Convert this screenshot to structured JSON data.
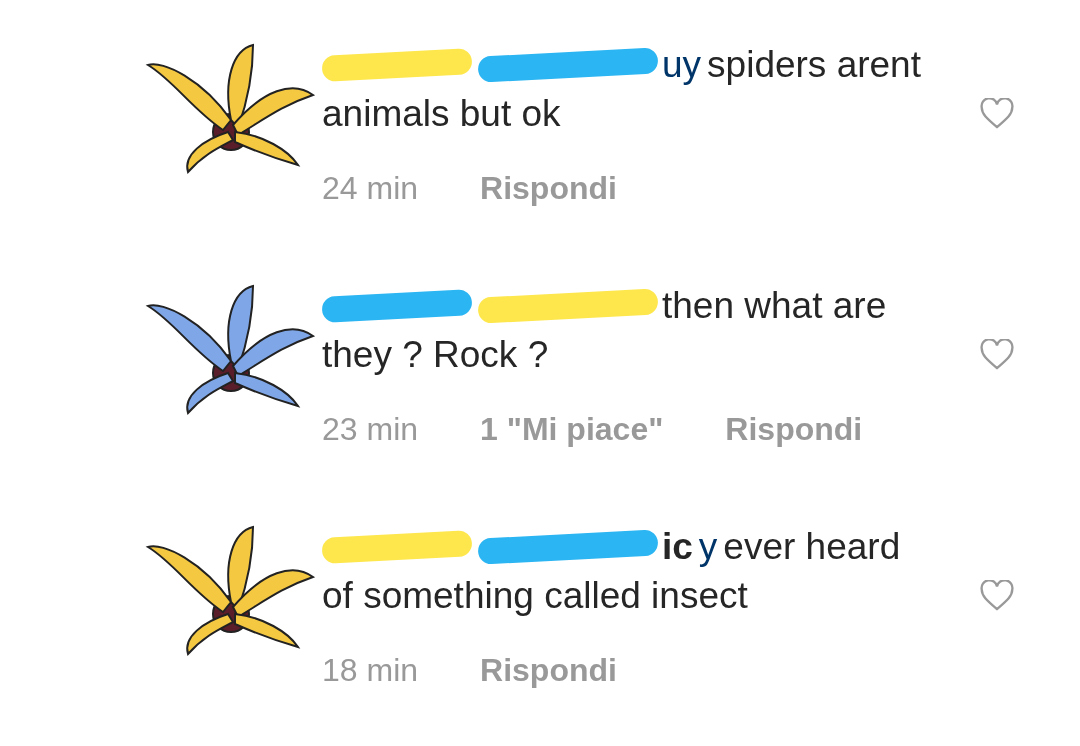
{
  "comments": [
    {
      "color": "#f5c842",
      "redactions": [
        {
          "color": "#fde74c"
        },
        {
          "color": "#2bb5f2"
        }
      ],
      "mention_tail": "uy",
      "text": "spiders arent animals but ok",
      "time": "24 min",
      "reply": "Rispondi",
      "liked": false
    },
    {
      "color": "#7fa7e8",
      "redactions": [
        {
          "color": "#2bb5f2"
        },
        {
          "color": "#fde74c"
        }
      ],
      "text": "then what are they ? Rock ?",
      "time": "23 min",
      "likes": "1 \"Mi piace\"",
      "reply": "Rispondi",
      "liked": false
    },
    {
      "color": "#f5c842",
      "redactions": [
        {
          "color": "#fde74c"
        },
        {
          "color": "#2bb5f2"
        }
      ],
      "name_tail": "ic",
      "mention_tail": "y",
      "text": "ever heard of something called insect",
      "time": "18 min",
      "reply": "Rispondi",
      "liked": false
    }
  ]
}
